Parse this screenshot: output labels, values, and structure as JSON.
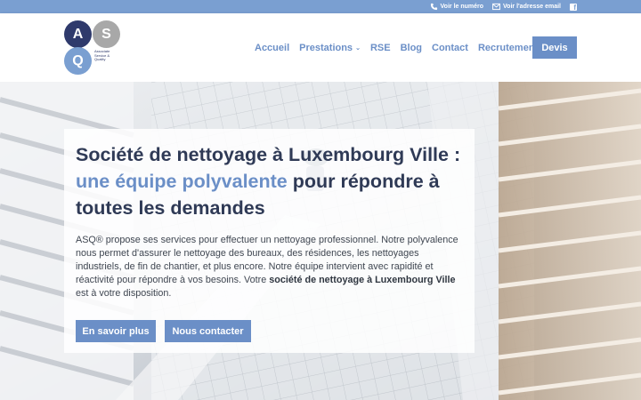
{
  "topbar": {
    "phone_label": "Voir le numéro",
    "email_label": "Voir l'adresse email",
    "facebook_glyph": "f"
  },
  "logo": {
    "letter_a": "A",
    "letter_s": "S",
    "letter_q": "Q",
    "subtitle": "Associate Service & Quality"
  },
  "nav": {
    "items": [
      "Accueil",
      "Prestations",
      "RSE",
      "Blog",
      "Contact",
      "Recrutement"
    ],
    "devis": "Devis"
  },
  "hero": {
    "title_part1": "Société de nettoyage à Luxembourg Ville :",
    "title_highlight": "une équipe polyvalente",
    "title_part2": "pour répondre à toutes les demandes",
    "paragraph_start": "ASQ® propose ses services pour effectuer un nettoyage professionnel. Notre polyvalence nous permet d'assurer le nettoyage des bureaux, des résidences, les nettoyages industriels, de fin de chantier, et plus encore. Notre équipe intervient avec rapidité et réactivité pour répondre à vos besoins. Votre",
    "paragraph_bold": "société de nettoyage à Luxembourg Ville",
    "paragraph_end": "est à votre disposition.",
    "button_more": "En savoir plus",
    "button_contact": "Nous contacter"
  },
  "colors": {
    "accent": "#6b8fc7",
    "navy": "#2f3a6c",
    "topbar": "#7a9fd1"
  }
}
